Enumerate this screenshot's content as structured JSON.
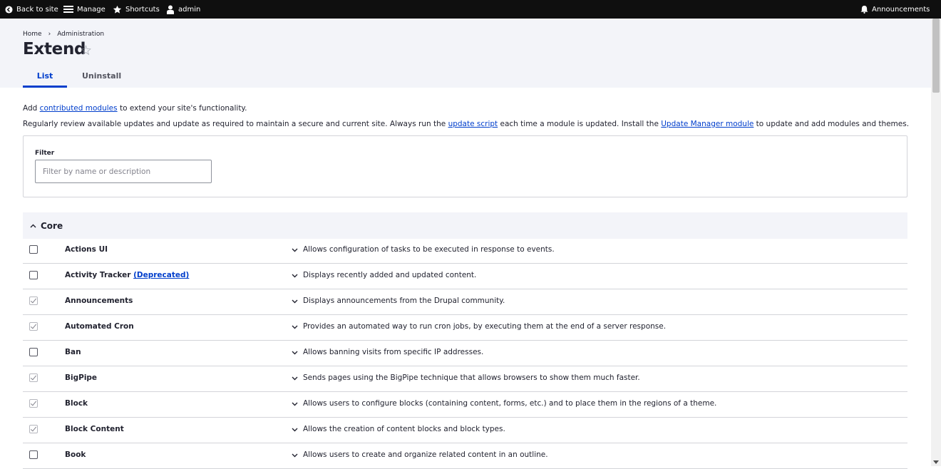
{
  "toolbar": {
    "back_label": "Back to site",
    "manage_label": "Manage",
    "shortcuts_label": "Shortcuts",
    "user_label": "admin",
    "announcements_label": "Announcements"
  },
  "breadcrumb": {
    "home": "Home",
    "separator": "›",
    "admin": "Administration"
  },
  "page": {
    "title": "Extend",
    "star": "☆"
  },
  "tabs": {
    "list": "List",
    "uninstall": "Uninstall"
  },
  "intro": {
    "line1_pre": "Add ",
    "line1_link": "contributed modules",
    "line1_post": " to extend your site's functionality.",
    "line2_pre": "Regularly review available updates and update as required to maintain a secure and current site. Always run the ",
    "line2_link1": "update script",
    "line2_mid": " each time a module is updated. Install the ",
    "line2_link2": "Update Manager module",
    "line2_post": " to update and add modules and themes."
  },
  "filter": {
    "label": "Filter",
    "placeholder": "Filter by name or description",
    "value": ""
  },
  "core": {
    "label": "Core",
    "modules": [
      {
        "name": "Actions UI",
        "desc": "Allows configuration of tasks to be executed in response to events.",
        "checked": false
      },
      {
        "name": "Activity Tracker",
        "tag": "(Deprecated)",
        "desc": "Displays recently added and updated content.",
        "checked": false
      },
      {
        "name": "Announcements",
        "desc": "Displays announcements from the Drupal community.",
        "checked": true
      },
      {
        "name": "Automated Cron",
        "desc": "Provides an automated way to run cron jobs, by executing them at the end of a server response.",
        "checked": true
      },
      {
        "name": "Ban",
        "desc": "Allows banning visits from specific IP addresses.",
        "checked": false
      },
      {
        "name": "BigPipe",
        "desc": "Sends pages using the BigPipe technique that allows browsers to show them much faster.",
        "checked": true
      },
      {
        "name": "Block",
        "desc": "Allows users to configure blocks (containing content, forms, etc.) and to place them in the regions of a theme.",
        "checked": true
      },
      {
        "name": "Block Content",
        "desc": "Allows the creation of content blocks and block types.",
        "checked": true
      },
      {
        "name": "Book",
        "desc": "Allows users to create and organize related content in an outline.",
        "checked": false
      }
    ]
  },
  "colors": {
    "link": "#003ecc",
    "toolbar_bg": "#0f0f0f",
    "header_bg": "#f3f4f9"
  }
}
